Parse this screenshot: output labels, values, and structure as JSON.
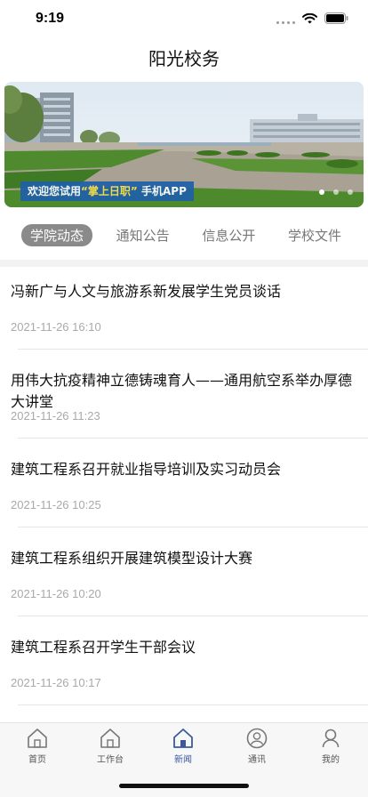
{
  "status_bar": {
    "time": "9:19"
  },
  "nav": {
    "title": "阳光校务"
  },
  "banner": {
    "caption_prefix": "欢迎您试用",
    "caption_highlight": "“掌上日职”",
    "caption_suffix": "手机APP",
    "page_count": 3,
    "active_page": 1
  },
  "tabs": [
    {
      "label": "学院动态",
      "active": true
    },
    {
      "label": "通知公告",
      "active": false
    },
    {
      "label": "信息公开",
      "active": false
    },
    {
      "label": "学校文件",
      "active": false
    }
  ],
  "news": [
    {
      "title": "冯新广与人文与旅游系新发展学生党员谈话",
      "time": "2021-11-26 16:10"
    },
    {
      "title": "用伟大抗疫精神立德铸魂育人——通用航空系举办厚德大讲堂",
      "time": "2021-11-26 11:23"
    },
    {
      "title": "建筑工程系召开就业指导培训及实习动员会",
      "time": "2021-11-26 10:25"
    },
    {
      "title": "建筑工程系组织开展建筑模型设计大赛",
      "time": "2021-11-26 10:20"
    },
    {
      "title": "建筑工程系召开学生干部会议",
      "time": "2021-11-26 10:17"
    }
  ],
  "tabbar": [
    {
      "label": "首页",
      "icon": "home-icon",
      "active": false
    },
    {
      "label": "工作台",
      "icon": "workbench-icon",
      "active": false
    },
    {
      "label": "新闻",
      "icon": "news-icon",
      "active": true
    },
    {
      "label": "通讯",
      "icon": "contacts-icon",
      "active": false
    },
    {
      "label": "我的",
      "icon": "profile-icon",
      "active": false
    }
  ],
  "colors": {
    "accent": "#3b5a9e",
    "tab_active_bg": "#8a8a8a",
    "time_text": "#a9a9a9"
  }
}
